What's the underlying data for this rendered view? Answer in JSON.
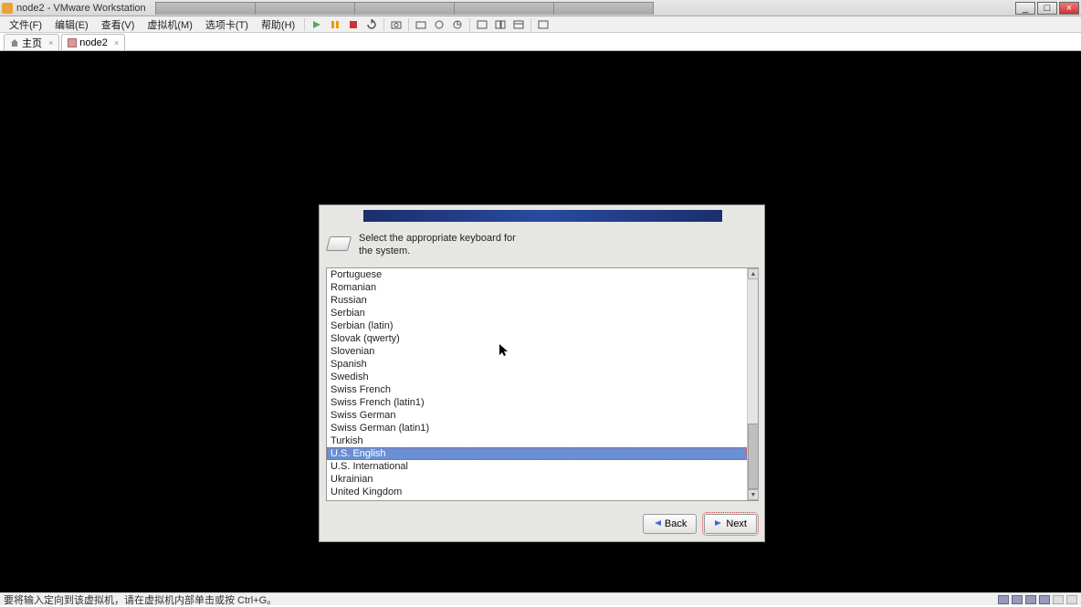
{
  "window": {
    "title": "node2 - VMware Workstation",
    "buttons": {
      "min": "_",
      "max": "□",
      "close": "×"
    }
  },
  "menubar": {
    "items": [
      "文件(F)",
      "编辑(E)",
      "查看(V)",
      "虚拟机(M)",
      "选项卡(T)",
      "帮助(H)"
    ]
  },
  "tabs": {
    "home": "主页",
    "vm": "node2"
  },
  "installer": {
    "header": "Select the appropriate keyboard for the system.",
    "options": [
      "Portuguese",
      "Romanian",
      "Russian",
      "Serbian",
      "Serbian (latin)",
      "Slovak (qwerty)",
      "Slovenian",
      "Spanish",
      "Swedish",
      "Swiss French",
      "Swiss French (latin1)",
      "Swiss German",
      "Swiss German (latin1)",
      "Turkish",
      "U.S. English",
      "U.S. International",
      "Ukrainian",
      "United Kingdom"
    ],
    "selected_index": 14,
    "back_label": "Back",
    "next_label": "Next"
  },
  "statusbar": {
    "message": "要将输入定向到该虚拟机，请在虚拟机内部单击或按 Ctrl+G。"
  }
}
